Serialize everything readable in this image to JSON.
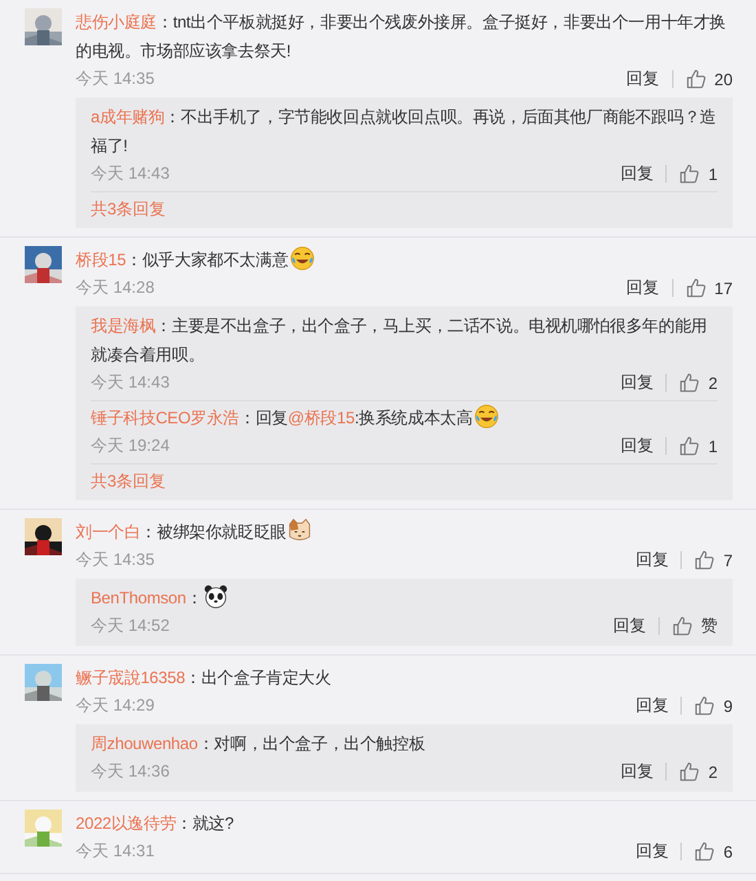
{
  "comments": [
    {
      "kind": "text",
      "avatar": {
        "kind": "picture"
      },
      "name": "悲伤小庭庭",
      "content": "：tnt出个平板就挺好，非要出个残废外接屏。盒子挺好，非要出个一用十年才换的电视。市场部应该拿去祭天!",
      "time": "今天 14:35",
      "reply_label": "回复",
      "likes": "20",
      "replies": [
        {
          "kind": "text",
          "name": "a成年赌狗",
          "content": "：不出手机了，字节能收回点就收回点呗。再说，后面其他厂商能不跟吗？造福了!",
          "time": "今天 14:43",
          "reply_label": "回复",
          "likes": "1"
        }
      ],
      "more": "共3条回复"
    },
    {
      "kind": "laugh",
      "avatar": {
        "kind": "picture"
      },
      "name": "桥段15",
      "content": "：似乎大家都不太满意",
      "time": "今天 14:28",
      "reply_label": "回复",
      "likes": "17",
      "replies": [
        {
          "kind": "text",
          "name": "我是海枫",
          "content": "：主要是不出盒子，出个盒子，马上买，二话不说。电视机哪怕很多年的能用就凑合着用呗。",
          "time": "今天 14:43",
          "reply_label": "回复",
          "likes": "2"
        },
        {
          "kind": "laugh",
          "name": "锤子科技CEO罗永浩",
          "prefix": "：回复",
          "mention": "@桥段15",
          "content": ":换系统成本太高",
          "time": "今天 19:24",
          "reply_label": "回复",
          "likes": "1"
        }
      ],
      "more": "共3条回复"
    },
    {
      "kind": "cat",
      "avatar": {
        "kind": "picture"
      },
      "name": "刘一个白",
      "content": "：被绑架你就眨眨眼",
      "time": "今天 14:35",
      "reply_label": "回复",
      "likes": "7",
      "replies": [
        {
          "kind": "panda",
          "name": "BenThomson",
          "content": "：",
          "time": "今天 14:52",
          "reply_label": "回复",
          "likes": "赞"
        }
      ]
    },
    {
      "kind": "text",
      "avatar": {
        "kind": "picture"
      },
      "name": "鳜子宬說16358",
      "content": "：出个盒子肯定大火",
      "time": "今天 14:29",
      "reply_label": "回复",
      "likes": "9",
      "replies": [
        {
          "kind": "text",
          "name": "周zhouwenhao",
          "content": "：对啊，出个盒子，出个触控板",
          "time": "今天 14:36",
          "reply_label": "回复",
          "likes": "2"
        }
      ]
    },
    {
      "kind": "text",
      "avatar": {
        "kind": "picture"
      },
      "name": "2022以逸待劳",
      "content": "：就这?",
      "time": "今天 14:31",
      "reply_label": "回复",
      "likes": "6"
    }
  ]
}
